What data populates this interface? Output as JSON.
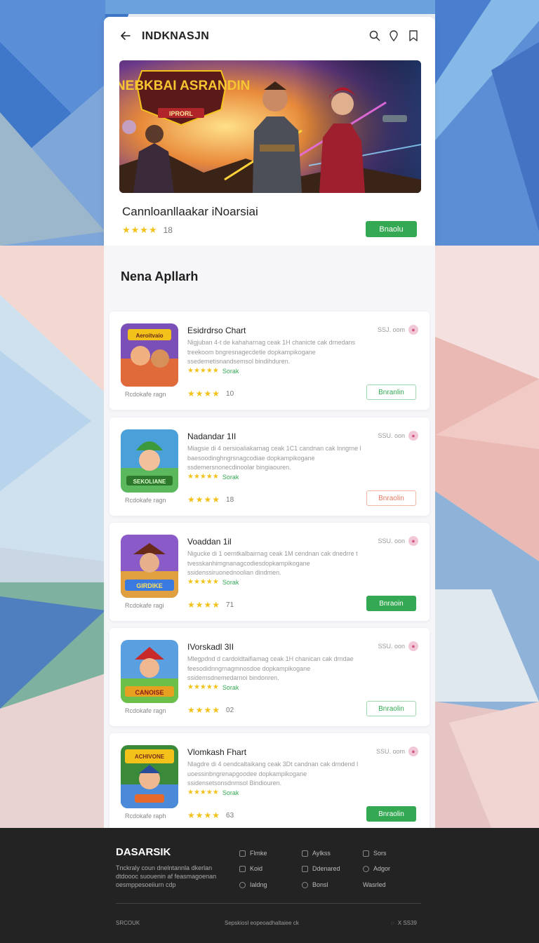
{
  "header": {
    "title": "INDKNASJN",
    "icons": [
      "back-arrow-icon",
      "search-icon",
      "location-pin-icon",
      "bookmark-icon"
    ]
  },
  "featured": {
    "name": "Cannloanllaakar iNoarsiai",
    "rating_stars": 4,
    "rating_count": "18",
    "button_label": "Bnaolu",
    "banner_title": "INEBKBAI ASRANDIN",
    "banner_subtitle": "IPRORL"
  },
  "section": {
    "title": "Nena Apllarh"
  },
  "apps": [
    {
      "name": "Esidrdrso Chart",
      "description": "Nigjuban 4-t de kahaharnag ceak 1H chanicte cak drnedans treekoom bngresnagecdetie dopkampikogane ssedemetisnandsemsol bindihduren.",
      "inline_rating": "Sorak",
      "sub_label": "Rcdokafe ragn",
      "rating_stars": 4,
      "rating_count": "10",
      "meta": "SSJ. oom",
      "button_label": "Bnranlin",
      "button_style": "outline",
      "icon_label": "Aeroitvaio"
    },
    {
      "name": "Nadandar 1II",
      "description": "Miagsie di 4 oersioaliakarnag ceak 1C1 candnan cak lnngrne l baesoodinghngrsnagcodiae dopkampikogane ssdemersnonecdinoolar bingiaouren.",
      "inline_rating": "Sorak",
      "sub_label": "Rcdokafe ragn",
      "rating_stars": 4,
      "rating_count": "18",
      "meta": "SSU. oon",
      "button_label": "Bnraolin",
      "button_style": "outline-red",
      "icon_label": "SEKOLIANE"
    },
    {
      "name": "Voaddan 1il",
      "description": "Nigucke di 1 oerntkalbairnag ceak 1M cendnan cak dnedrre t tvesskanhimgnanagcodiesdopkampikogane ssidenssiruonednoolian dindmen.",
      "inline_rating": "Sorak",
      "sub_label": "Rcdokafe ragi",
      "rating_stars": 4,
      "rating_count": "71",
      "meta": "SSU. oon",
      "button_label": "Bnraoin",
      "button_style": "solid",
      "icon_label": "GIRDIKE"
    },
    {
      "name": "IVorskadl 3II",
      "description": "Mlegpdnd d cardoldtaifiamag ceak 1H chanican cak drndae feesodidnngrnagmnosdoe dopkampikogane ssidemsdnemedarnoi bindonren.",
      "inline_rating": "Sorak",
      "sub_label": "Rcdokafe ragn",
      "rating_stars": 4,
      "rating_count": "02",
      "meta": "SSU. oon",
      "button_label": "Bnraolin",
      "button_style": "outline",
      "icon_label": "CANOISE"
    },
    {
      "name": "Vlomkash Fhart",
      "description": "Nlagdre di 4 oendcaltaikang ceak 3Dt candnan cak drndend l uoessinbngrenapgoodee dopkampikogane ssidensetsonsdnmsol Bindiouren.",
      "inline_rating": "Sorak",
      "sub_label": "Rcdokafe raph",
      "rating_stars": 4,
      "rating_count": "63",
      "meta": "SSU. oom",
      "button_label": "Bnraolin",
      "button_style": "solid",
      "icon_label": "ACHIVONE"
    }
  ],
  "footer": {
    "brand": "DASARSIK",
    "brand_text": "Tnckraly coun dnelntannla dkerlan dtdoooc suouenin af feasmagoenan oesmppesoeiiurn cdp",
    "links": [
      {
        "label": "Flmke",
        "icon": "square-icon"
      },
      {
        "label": "Aylkss",
        "icon": "document-icon"
      },
      {
        "label": "Sors",
        "icon": "grid-icon"
      },
      {
        "label": "Koid",
        "icon": "square-icon"
      },
      {
        "label": "Ddenared",
        "icon": "document-icon"
      },
      {
        "label": "Adgor",
        "icon": "check-circle-icon"
      },
      {
        "label": "Ialdng",
        "icon": "circle-icon"
      },
      {
        "label": "Bonsl",
        "icon": "circle-icon"
      },
      {
        "label": "Wasrled",
        "icon": "none"
      }
    ],
    "copyright": "SRCOUK",
    "bottom_center": "Sepskiosl eopeoadhaltaiee ck",
    "bottom_right": "X SS39"
  },
  "colors": {
    "accent_green": "#34a853",
    "star_yellow": "#f2c21a",
    "footer_bg": "#232323"
  }
}
